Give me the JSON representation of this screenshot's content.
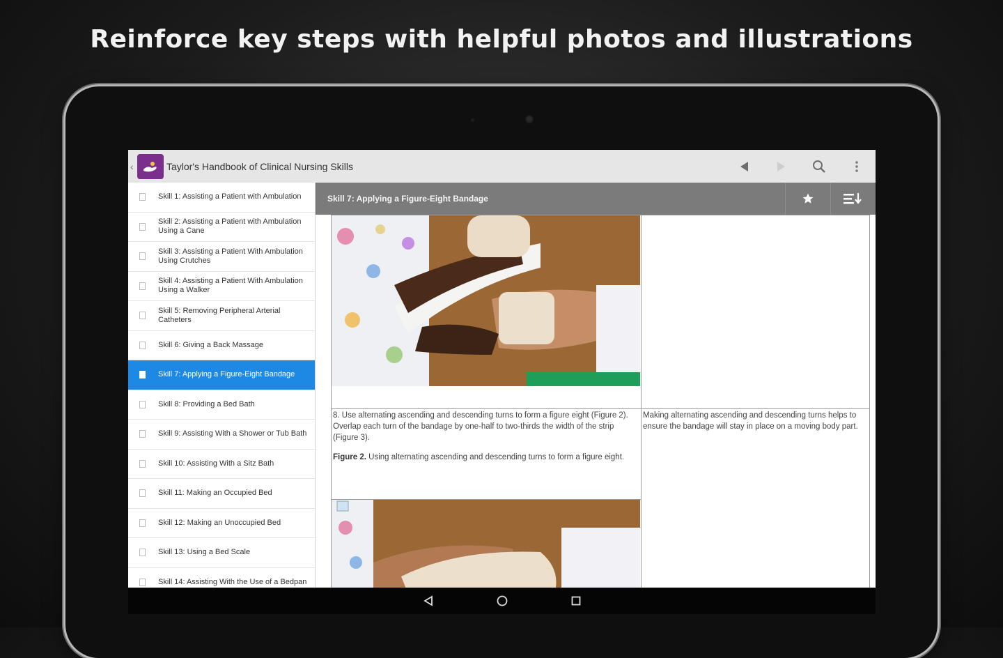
{
  "headline": "Reinforce key steps with helpful photos and illustrations",
  "app": {
    "title": "Taylor's Handbook of Clinical Nursing Skills"
  },
  "sidebar": {
    "items": [
      {
        "label": "Skill 1: Assisting a Patient with Ambulation"
      },
      {
        "label": "Skill 2: Assisting a Patient with Ambulation Using a Cane"
      },
      {
        "label": "Skill 3: Assisting a Patient With Ambulation Using Crutches"
      },
      {
        "label": "Skill 4: Assisting a Patient With Ambulation Using a Walker"
      },
      {
        "label": "Skill 5: Removing Peripheral Arterial Catheters"
      },
      {
        "label": "Skill 6: Giving a Back Massage"
      },
      {
        "label": "Skill 7: Applying a Figure-Eight Bandage"
      },
      {
        "label": "Skill 8: Providing a Bed Bath"
      },
      {
        "label": "Skill 9: Assisting With a Shower or Tub Bath"
      },
      {
        "label": "Skill 10: Assisting With a Sitz Bath"
      },
      {
        "label": "Skill 11: Making an Occupied Bed"
      },
      {
        "label": "Skill 12: Making an Unoccupied Bed"
      },
      {
        "label": "Skill 13: Using a Bed Scale"
      },
      {
        "label": "Skill 14: Assisting With the Use of a Bedpan"
      }
    ],
    "active_index": 6
  },
  "content": {
    "title": "Skill 7: Applying a Figure-Eight Bandage",
    "step_text": "8. Use alternating ascending and descending turns to form a figure eight (Figure 2). Overlap each turn of the bandage by one-half to two-thirds the width of the strip (Figure 3).",
    "figure_label": "Figure 2.",
    "figure_caption": "Using alternating ascending and descending turns to form a figure eight.",
    "rationale_text": "Making alternating ascending and descending turns helps to ensure the bandage will stay in place on a moving body part."
  },
  "icons": {
    "back": "back-arrow-icon",
    "forward": "forward-arrow-icon",
    "search": "search-icon",
    "overflow": "overflow-menu-icon",
    "bookmark": "star-icon",
    "toc": "sort-list-icon"
  },
  "colors": {
    "accent": "#1e88e5",
    "app_logo": "#7b2f8c",
    "content_bar": "#7b7b7b"
  }
}
